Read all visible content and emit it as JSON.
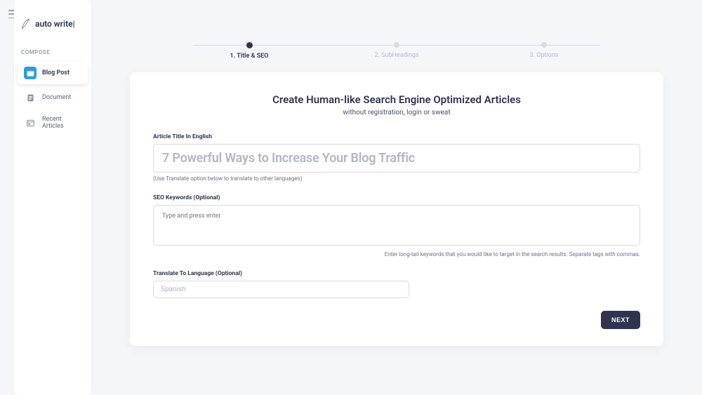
{
  "brand": {
    "name": "auto write|"
  },
  "sidebar": {
    "section": "COMPOSE",
    "items": [
      {
        "label": "Blog Post",
        "icon": "blog-post-icon",
        "active": true
      },
      {
        "label": "Document",
        "icon": "document-icon",
        "active": false
      },
      {
        "label": "Recent Articles",
        "icon": "recent-icon",
        "active": false
      }
    ]
  },
  "stepper": {
    "steps": [
      {
        "label": "1. Title & SEO",
        "active": true
      },
      {
        "label": "2. SubHeadings",
        "active": false
      },
      {
        "label": "3. Options",
        "active": false
      }
    ]
  },
  "card": {
    "heading": "Create Human-like Search Engine Optimized Articles",
    "subtitle": "without registration, login or sweat",
    "title_field": {
      "label": "Article Title In English",
      "placeholder": "7 Powerful Ways to Increase Your Blog Traffic",
      "hint": "(Use Translate option below to translate to other languages)"
    },
    "seo_field": {
      "label": "SEO Keywords (Optional)",
      "placeholder": "Type and press enter",
      "hint": "Enter long-tail keywords that you would like to target in the search results. Separate tags with commas."
    },
    "translate_field": {
      "label": "Translate To Language (Optional)",
      "placeholder": "Spanish"
    },
    "next_button": "NEXT"
  }
}
